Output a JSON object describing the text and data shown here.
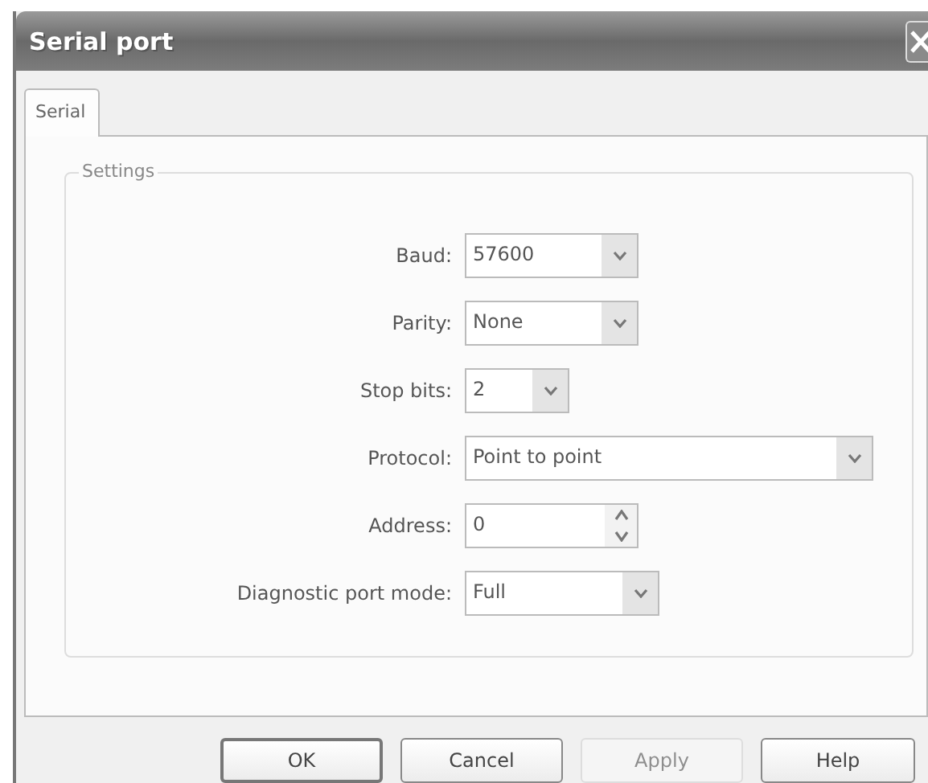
{
  "window": {
    "title": "Serial port"
  },
  "tabs": [
    {
      "label": "Serial",
      "selected": true
    }
  ],
  "group": {
    "title": "Settings"
  },
  "fields": [
    {
      "label": "Baud:",
      "value": "57600",
      "kind": "dropdown"
    },
    {
      "label": "Parity:",
      "value": "None",
      "kind": "dropdown"
    },
    {
      "label": "Stop bits:",
      "value": "2",
      "kind": "dropdown"
    },
    {
      "label": "Protocol:",
      "value": "Point to point",
      "kind": "dropdown"
    },
    {
      "label": "Address:",
      "value": "0",
      "kind": "spinner"
    },
    {
      "label": "Diagnostic port mode:",
      "value": "Full",
      "kind": "dropdown"
    }
  ],
  "buttons": [
    {
      "label": "OK",
      "disabled": false,
      "default": true
    },
    {
      "label": "Cancel",
      "disabled": false,
      "default": false
    },
    {
      "label": "Apply",
      "disabled": true,
      "default": false
    },
    {
      "label": "Help",
      "disabled": false,
      "default": false
    }
  ]
}
